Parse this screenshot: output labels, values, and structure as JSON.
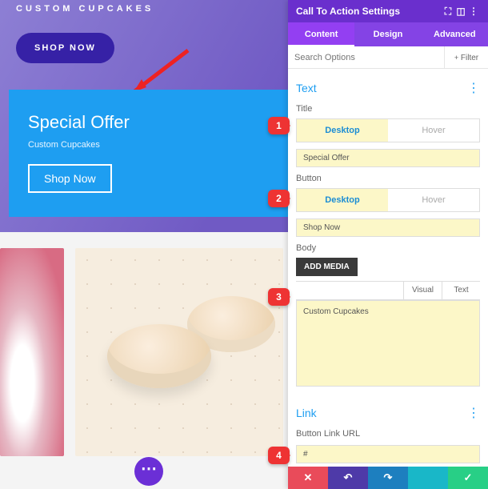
{
  "hero": {
    "subtitle": "CUSTOM CUPCAKES",
    "button": "SHOP NOW"
  },
  "cta": {
    "title": "Special Offer",
    "subtitle": "Custom Cupcakes",
    "button": "Shop Now"
  },
  "panel": {
    "title": "Call To Action Settings",
    "tabs": [
      "Content",
      "Design",
      "Advanced"
    ],
    "search_placeholder": "Search Options",
    "filter": "Filter",
    "sections": {
      "text": {
        "heading": "Text",
        "title_label": "Title",
        "title_tabs": [
          "Desktop",
          "Hover"
        ],
        "title_value": "Special Offer",
        "button_label": "Button",
        "button_tabs": [
          "Desktop",
          "Hover"
        ],
        "button_value": "Shop Now",
        "body_label": "Body",
        "add_media": "ADD MEDIA",
        "body_tabs": [
          "Visual",
          "Text"
        ],
        "body_value": "Custom Cupcakes"
      },
      "link": {
        "heading": "Link",
        "url_label": "Button Link URL",
        "url_value": "#"
      }
    }
  },
  "badges": [
    "1",
    "2",
    "3",
    "4"
  ],
  "fab": "⋯",
  "dock_colors": [
    "#e94b5a",
    "#4e3aa8",
    "#1d7fbf",
    "#19b7c8",
    "#28cf86"
  ],
  "dock_icons": [
    "✕",
    "↶",
    "↷",
    "",
    ""
  ]
}
